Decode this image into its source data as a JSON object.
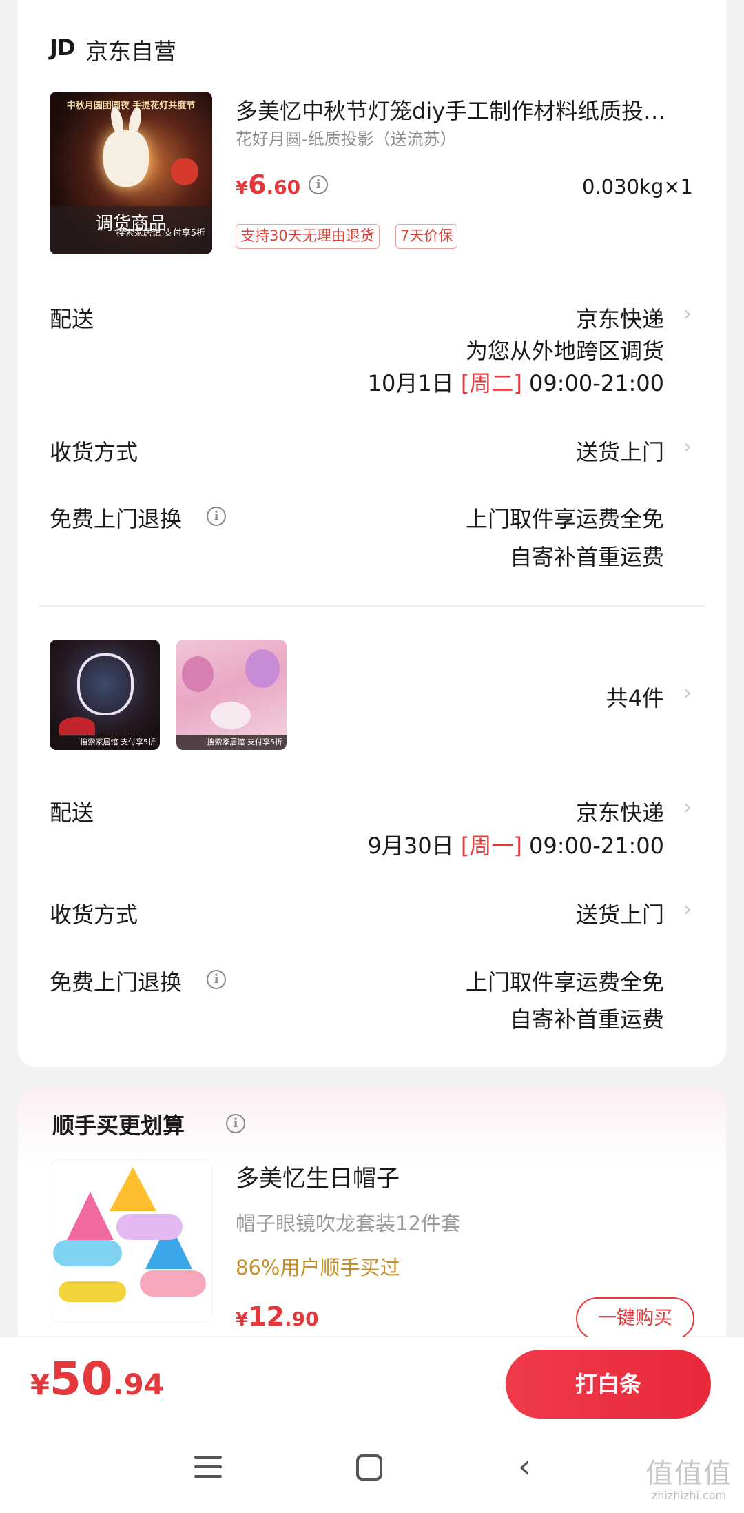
{
  "shop": {
    "logo": "JD",
    "name": "京东自营"
  },
  "item1": {
    "image_title": "中秋月圆团圆夜 手提花灯共度节",
    "overlay_label": "调货商品",
    "overlay_sub": "搜索家居馆 支付享5折",
    "title": "多美忆中秋节灯笼diy手工制作材料纸质投…",
    "spec": "花好月圆-纸质投影（送流苏）",
    "price": {
      "currency": "¥",
      "int": "6",
      "dec": ".60"
    },
    "weight": "0.030kg×1",
    "tags": [
      "支持30天无理由退货",
      "7天价保"
    ]
  },
  "group1": {
    "delivery_label": "配送",
    "delivery_value": "京东快递",
    "delivery_note": "为您从外地跨区调货",
    "delivery_date": "10月1日",
    "delivery_weekday": "[周二]",
    "delivery_time": "09:00-21:00",
    "receive_label": "收货方式",
    "receive_value": "送货上门",
    "return_label": "免费上门退换",
    "return_line1": "上门取件享运费全免",
    "return_line2": "自寄补首重运费"
  },
  "group2": {
    "thumb_strip": "搜索家居馆 支付享5折",
    "count_label": "共4件",
    "delivery_label": "配送",
    "delivery_value": "京东快递",
    "delivery_date": "9月30日",
    "delivery_weekday": "[周一]",
    "delivery_time": "09:00-21:00",
    "receive_label": "收货方式",
    "receive_value": "送货上门",
    "return_label": "免费上门退换",
    "return_line1": "上门取件享运费全免",
    "return_line2": "自寄补首重运费"
  },
  "addon": {
    "section_title": "顺手买更划算",
    "name": "多美忆生日帽子",
    "sub": "帽子眼镜吹龙套装12件套",
    "social": "86%用户顺手买过",
    "price": {
      "currency": "¥",
      "int": "12",
      "dec": ".90"
    },
    "buy_button": "一键购买"
  },
  "bottom": {
    "total": {
      "currency": "¥",
      "int": "50",
      "dec": ".94"
    },
    "pay_button": "打白条"
  },
  "watermark": {
    "main": "值值值",
    "sub": "zhizhizhi.com"
  },
  "icons": {
    "info": "info-circle-icon",
    "chevron": "chevron-right-icon",
    "nav": [
      "menu-icon",
      "home-icon",
      "back-icon"
    ]
  },
  "colors": {
    "accent": "#e4393c",
    "social": "#c8902b"
  }
}
